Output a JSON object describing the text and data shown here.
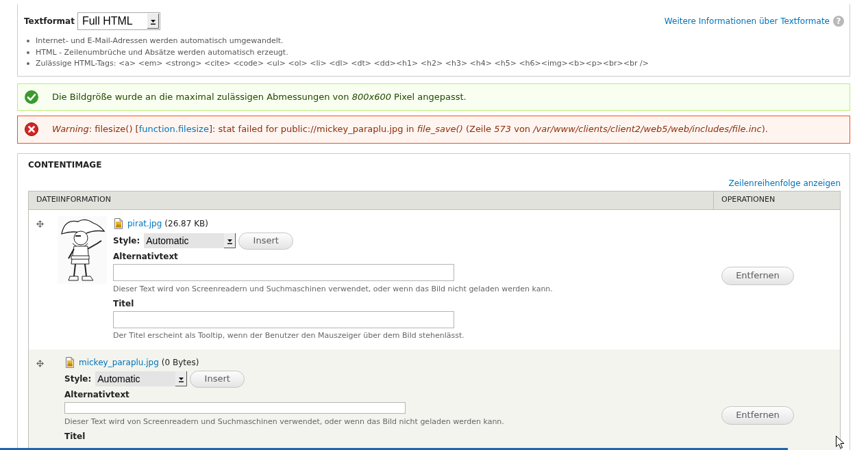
{
  "text_format": {
    "label": "Textformat",
    "value": "Full HTML",
    "help_link": "Weitere Informationen über Textformate",
    "help_icon": "?",
    "tips": [
      "Internet- und E-Mail-Adressen werden automatisch umgewandelt.",
      "HTML - Zeilenumbrüche und Absätze werden automatisch erzeugt.",
      "Zulässige HTML-Tags: <a> <em> <strong> <cite> <code> <ul> <ol> <li> <dl> <dt> <dd><h1> <h2> <h3> <h4> <h5> <h6><img><b><p><br><br />"
    ]
  },
  "messages": [
    {
      "kind": "status",
      "text": "Die Bildgröße wurde an die maximal zulässigen Abmessungen von *800x600* Pixel angepasst."
    },
    {
      "kind": "error",
      "text": "*Warning*: filesize() [",
      "link": "function.filesize",
      "text_after": "]: stat failed for public://mickey_paraplu.jpg in *file_save()* (Zeile *573* von */var/www/clients/client2/web5/web/includes/file.inc*)."
    }
  ],
  "fieldset": {
    "legend": "CONTENTIMAGE",
    "row_order_link": "Zeilenreihenfolge anzeigen",
    "table": {
      "columns": [
        "DATEIINFORMATION",
        "OPERATIONEN"
      ],
      "rows": [
        {
          "preview": true,
          "file_name": "pirat.jpg",
          "file_size": "(26.87 KB)",
          "style_label": "Style:",
          "style_value": "Automatic",
          "insert_button": "Insert",
          "fields": [
            {
              "label": "Alternativtext",
              "input": true,
              "description": "Dieser Text wird von Screenreadern und Suchmaschinen verwendet, oder wenn das Bild nicht geladen werden kann."
            },
            {
              "label": "Titel",
              "input": true,
              "description": "Der Titel erscheint als Tooltip, wenn der Benutzer den Mauszeiger über dem Bild stehenlässt."
            }
          ],
          "remove_button": "Entfernen"
        },
        {
          "preview": false,
          "file_name": "mickey_paraplu.jpg",
          "file_size": "(0 Bytes)",
          "style_label": "Style:",
          "style_value": "Automatic",
          "insert_button": "Insert",
          "fields": [
            {
              "label": "Alternativtext",
              "input": true,
              "description": "Dieser Text wird von Screenreadern und Suchmaschinen verwendet, oder wenn das Bild nicht geladen werden kann."
            },
            {
              "label": "Titel",
              "input": false
            }
          ],
          "remove_button": "Entfernen"
        }
      ]
    }
  }
}
